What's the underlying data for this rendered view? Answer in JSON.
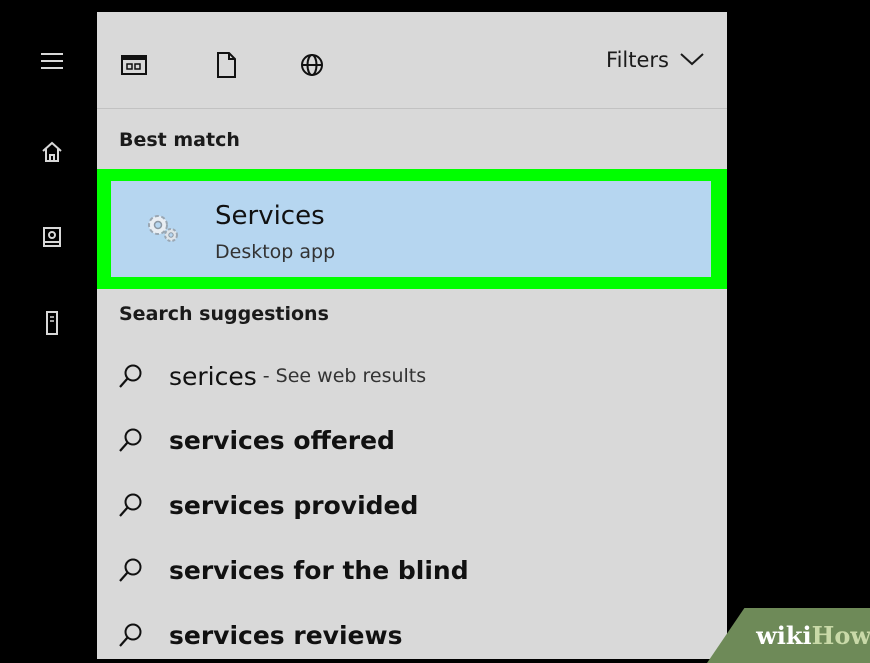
{
  "colors": {
    "highlight_border": "#00ff00",
    "selected_bg": "#b6d6f0",
    "panel_bg": "#d9d9d9"
  },
  "rail": {
    "icons": [
      "hamburger-menu-icon",
      "home-icon",
      "notebook-icon",
      "tower-icon"
    ]
  },
  "toolbar": {
    "icons": [
      "apps-icon",
      "documents-icon",
      "web-icon"
    ],
    "filters_label": "Filters"
  },
  "best_match": {
    "heading": "Best match",
    "title": "Services",
    "subtitle": "Desktop app",
    "icon": "services-gear-icon"
  },
  "suggestions": {
    "heading": "Search suggestions",
    "items": [
      {
        "text": "serices",
        "suffix": "- See web results"
      },
      {
        "text": "services offered"
      },
      {
        "text": "services provided"
      },
      {
        "text": "services for the blind"
      },
      {
        "text": "services reviews"
      }
    ]
  },
  "watermark": {
    "part1": "wiki",
    "part2": "How"
  }
}
